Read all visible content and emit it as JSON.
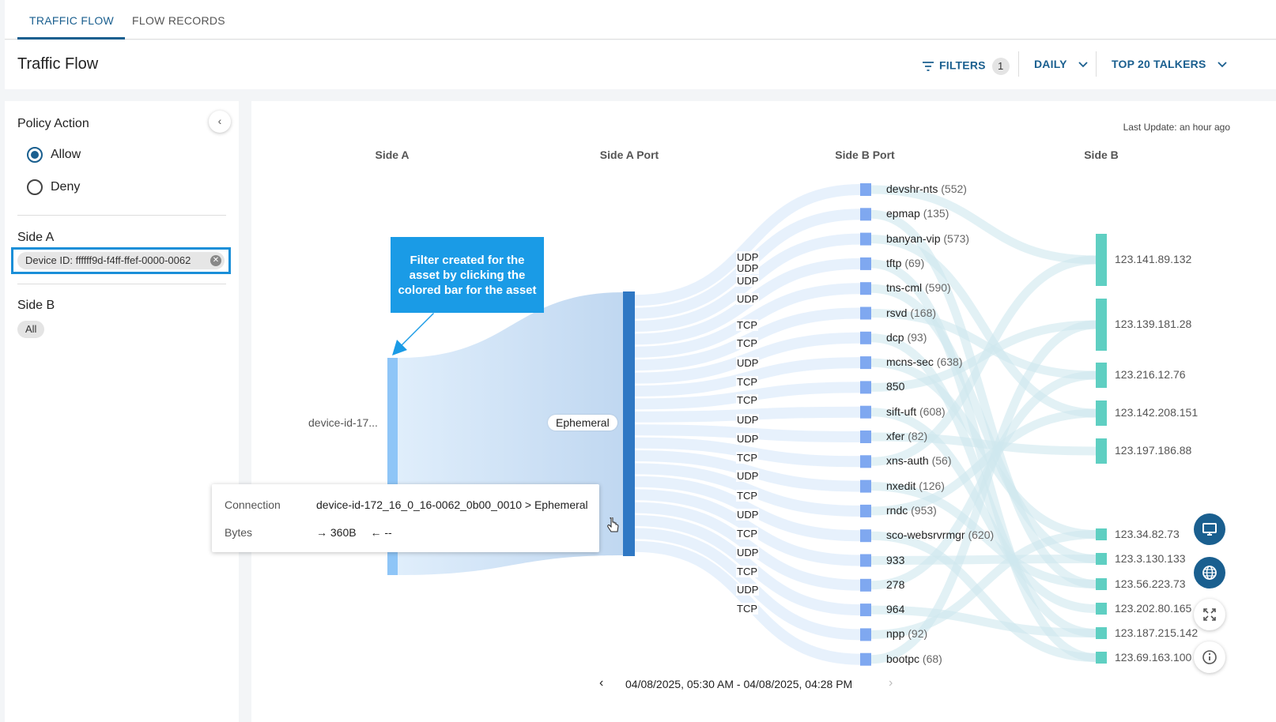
{
  "tabs": [
    {
      "label": "TRAFFIC FLOW",
      "active": true
    },
    {
      "label": "FLOW RECORDS",
      "active": false
    }
  ],
  "header": {
    "title": "Traffic Flow",
    "filters_label": "FILTERS",
    "filters_count": "1",
    "period_label": "DAILY",
    "talkers_label": "TOP 20 TALKERS"
  },
  "sidebar": {
    "policy_action_title": "Policy Action",
    "allow_label": "Allow",
    "deny_label": "Deny",
    "selected": "Allow",
    "side_a_title": "Side A",
    "side_a_chip": "Device ID: ffffff9d-f4ff-ffef-0000-0062",
    "side_b_title": "Side B",
    "side_b_chip": "All"
  },
  "main": {
    "last_update": "Last Update: an hour ago",
    "columns": {
      "side_a": "Side A",
      "side_a_port": "Side A Port",
      "side_b_port": "Side B Port",
      "side_b": "Side B"
    },
    "side_a_node": "device-id-17...",
    "side_a_port_node": "Ephemeral",
    "callout": "Filter created for the asset by clicking the colored bar for the asset",
    "protocols": [
      "UDP",
      "UDP",
      "UDP",
      "UDP",
      "TCP",
      "TCP",
      "UDP",
      "TCP",
      "TCP",
      "UDP",
      "UDP",
      "TCP",
      "UDP",
      "TCP",
      "UDP",
      "TCP",
      "UDP",
      "TCP",
      "UDP",
      "TCP"
    ],
    "side_b_ports": [
      {
        "name": "devshr-nts",
        "count": "(552)"
      },
      {
        "name": "epmap",
        "count": "(135)"
      },
      {
        "name": "banyan-vip",
        "count": "(573)"
      },
      {
        "name": "tftp",
        "count": "(69)"
      },
      {
        "name": "tns-cml",
        "count": "(590)"
      },
      {
        "name": "rsvd",
        "count": "(168)"
      },
      {
        "name": "dcp",
        "count": "(93)"
      },
      {
        "name": "mcns-sec",
        "count": "(638)"
      },
      {
        "name": "850",
        "count": ""
      },
      {
        "name": "sift-uft",
        "count": "(608)"
      },
      {
        "name": "xfer",
        "count": "(82)"
      },
      {
        "name": "xns-auth",
        "count": "(56)"
      },
      {
        "name": "nxedit",
        "count": "(126)"
      },
      {
        "name": "rndc",
        "count": "(953)"
      },
      {
        "name": "sco-websrvrmgr",
        "count": "(620)"
      },
      {
        "name": "933",
        "count": ""
      },
      {
        "name": "278",
        "count": ""
      },
      {
        "name": "964",
        "count": ""
      },
      {
        "name": "npp",
        "count": "(92)"
      },
      {
        "name": "bootpc",
        "count": "(68)"
      }
    ],
    "side_b_ips": [
      "123.141.89.132",
      "123.139.181.28",
      "123.216.12.76",
      "123.142.208.151",
      "123.197.186.88",
      "123.34.82.73",
      "123.3.130.133",
      "123.56.223.73",
      "123.202.80.165",
      "123.187.215.142",
      "123.69.163.100"
    ],
    "tooltip": {
      "connection_key": "Connection",
      "connection_val": "device-id-172_16_0_16-0062_0b00_0010 > Ephemeral",
      "bytes_key": "Bytes",
      "bytes_out": "360B",
      "bytes_in": "--"
    },
    "date_range": "04/08/2025, 05:30 AM - 04/08/2025, 04:28 PM"
  },
  "colors": {
    "accent": "#1a5f8f",
    "callout": "#1a9be6",
    "port_node": "#7fa8f0",
    "ip_node": "#5fcfc2"
  }
}
